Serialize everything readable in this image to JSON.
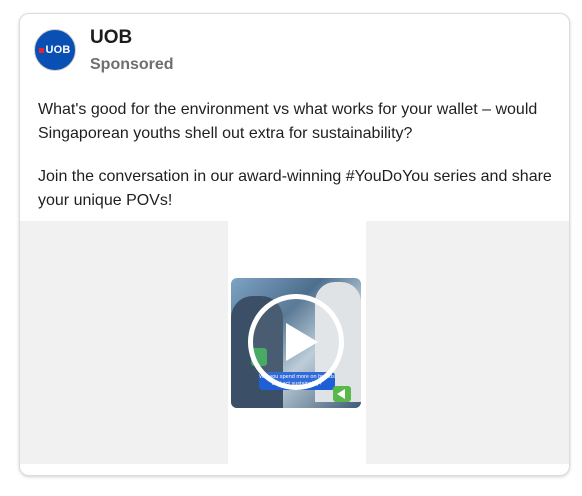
{
  "ad": {
    "advertiser": "UOB",
    "logo_text": "UOB",
    "sponsored_label": "Sponsored",
    "body_paragraph_1": "What's good for the environment vs what works for your wallet – would Singaporean youths shell out extra for sustainability?",
    "body_paragraph_2": "Join the conversation in our award-winning #YouDoYou series and share your unique POVs!",
    "video_caption": "Will you spend more on brands that act sustainably?"
  },
  "icons": {
    "logo": "uob-logo-icon",
    "play": "play-icon",
    "sound": "sound-icon"
  },
  "colors": {
    "brand_blue": "#0a4fb3",
    "brand_red": "#e3262f",
    "caption_blue": "#1f5fd6",
    "sound_green": "#58b84a",
    "media_background": "#f1f1f1"
  }
}
